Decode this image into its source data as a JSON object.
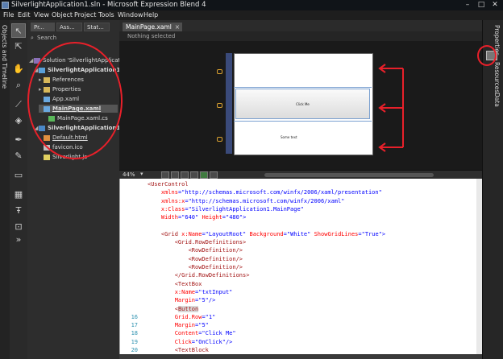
{
  "window": {
    "title": "SilverlightApplication1.sln - Microsoft Expression Blend 4",
    "minimize": "–",
    "maximize": "□",
    "close": "✕"
  },
  "menu": [
    "File",
    "Edit",
    "View",
    "Object",
    "Project",
    "Tools",
    "Window",
    "Help"
  ],
  "left_strip_label": "Objects and Timeline",
  "tools": [
    "selection-icon",
    "direct-select-icon",
    "pan-icon",
    "zoom-icon",
    "eyedropper-icon",
    "paint-bucket-icon",
    "pen-icon",
    "brush-icon",
    "rectangle-icon",
    "layout-grid-icon",
    "textblock-icon",
    "assets-icon",
    "more-tools-icon"
  ],
  "panel": {
    "tabs": [
      "Pr...",
      "Ass...",
      "Stat..."
    ],
    "search_placeholder": "Search",
    "tree": [
      {
        "label": "Solution 'SilverlightApplication",
        "level": 0,
        "icon": "solution-icon"
      },
      {
        "label": "SilverlightApplication1",
        "level": 1,
        "icon": "project-icon",
        "bold": true
      },
      {
        "label": "References",
        "level": 2,
        "icon": "folder-icon"
      },
      {
        "label": "Properties",
        "level": 2,
        "icon": "folder-icon"
      },
      {
        "label": "App.xaml",
        "level": 2,
        "icon": "xaml-file-icon"
      },
      {
        "label": "MainPage.xaml",
        "level": 2,
        "icon": "xaml-file-icon",
        "selected": true,
        "bold": true
      },
      {
        "label": "MainPage.xaml.cs",
        "level": 3,
        "icon": "cs-file-icon"
      },
      {
        "label": "SilverlightApplication1Site",
        "level": 1,
        "icon": "web-project-icon",
        "bold": true
      },
      {
        "label": "Default.html",
        "level": 2,
        "icon": "html-file-icon"
      },
      {
        "label": "favicon.ico",
        "level": 2,
        "icon": "ico-file-icon"
      },
      {
        "label": "Silverlight.js",
        "level": 2,
        "icon": "js-file-icon"
      }
    ]
  },
  "document": {
    "tab_label": "MainPage.xaml",
    "tab_close": "×",
    "selection_info": "Nothing selected",
    "button_text": "Click Me",
    "textblock_text": "Some text"
  },
  "right_strip": [
    "Properties",
    "Resources",
    "Data"
  ],
  "zoom": "44%",
  "code_lines": [
    {
      "n": "",
      "parts": [
        [
          "t",
          "<UserControl"
        ]
      ]
    },
    {
      "n": "",
      "parts": [
        [
          "a",
          "    xmlns"
        ],
        [
          "p",
          "=\""
        ],
        [
          "v",
          "http://schemas.microsoft.com/winfx/2006/xaml/presentation"
        ],
        [
          "p",
          "\""
        ]
      ]
    },
    {
      "n": "",
      "parts": [
        [
          "a",
          "    xmlns:x"
        ],
        [
          "p",
          "=\""
        ],
        [
          "v",
          "http://schemas.microsoft.com/winfx/2006/xaml"
        ],
        [
          "p",
          "\""
        ]
      ]
    },
    {
      "n": "",
      "parts": [
        [
          "a",
          "    x:Class"
        ],
        [
          "p",
          "=\""
        ],
        [
          "v",
          "SilverlightApplication1.MainPage"
        ],
        [
          "p",
          "\""
        ]
      ]
    },
    {
      "n": "",
      "parts": [
        [
          "a",
          "    Width"
        ],
        [
          "p",
          "=\""
        ],
        [
          "v",
          "640"
        ],
        [
          "p",
          "\" "
        ],
        [
          "a",
          "Height"
        ],
        [
          "p",
          "=\""
        ],
        [
          "v",
          "480"
        ],
        [
          "p",
          "\">"
        ]
      ]
    },
    {
      "n": "",
      "parts": []
    },
    {
      "n": "",
      "parts": [
        [
          "t",
          "    <Grid "
        ],
        [
          "a",
          "x:Name"
        ],
        [
          "p",
          "=\""
        ],
        [
          "v",
          "LayoutRoot"
        ],
        [
          "p",
          "\" "
        ],
        [
          "a",
          "Background"
        ],
        [
          "p",
          "=\""
        ],
        [
          "v",
          "White"
        ],
        [
          "p",
          "\" "
        ],
        [
          "a",
          "ShowGridLines"
        ],
        [
          "p",
          "=\""
        ],
        [
          "v",
          "True"
        ],
        [
          "p",
          "\">"
        ]
      ]
    },
    {
      "n": "",
      "parts": [
        [
          "t",
          "        <Grid.RowDefinitions>"
        ]
      ]
    },
    {
      "n": "",
      "parts": [
        [
          "t",
          "            <RowDefinition/>"
        ]
      ]
    },
    {
      "n": "",
      "parts": [
        [
          "t",
          "            <RowDefinition/>"
        ]
      ]
    },
    {
      "n": "",
      "parts": [
        [
          "t",
          "            <RowDefinition/>"
        ]
      ]
    },
    {
      "n": "",
      "parts": [
        [
          "t",
          "        </Grid.RowDefinitions>"
        ]
      ]
    },
    {
      "n": "",
      "parts": [
        [
          "t",
          "        <TextBox"
        ]
      ]
    },
    {
      "n": "",
      "parts": [
        [
          "a",
          "        x:Name"
        ],
        [
          "p",
          "=\""
        ],
        [
          "v",
          "txtInput"
        ],
        [
          "p",
          "\""
        ]
      ]
    },
    {
      "n": "",
      "parts": [
        [
          "a",
          "        Margin"
        ],
        [
          "p",
          "=\""
        ],
        [
          "v",
          "5"
        ],
        [
          "p",
          "\"/>"
        ]
      ]
    },
    {
      "n": "",
      "parts": [
        [
          "t",
          "        <"
        ],
        [
          "h",
          "Button"
        ]
      ]
    },
    {
      "n": "16",
      "parts": [
        [
          "a",
          "        Grid.Row"
        ],
        [
          "p",
          "=\""
        ],
        [
          "v",
          "1"
        ],
        [
          "p",
          "\""
        ]
      ]
    },
    {
      "n": "17",
      "parts": [
        [
          "a",
          "        Margin"
        ],
        [
          "p",
          "=\""
        ],
        [
          "v",
          "5"
        ],
        [
          "p",
          "\""
        ]
      ]
    },
    {
      "n": "18",
      "parts": [
        [
          "a",
          "        Content"
        ],
        [
          "p",
          "=\""
        ],
        [
          "v",
          "Click Me"
        ],
        [
          "p",
          "\""
        ]
      ]
    },
    {
      "n": "19",
      "parts": [
        [
          "a",
          "        Click"
        ],
        [
          "p",
          "=\""
        ],
        [
          "v",
          "OnClick"
        ],
        [
          "p",
          "\"/>"
        ]
      ]
    },
    {
      "n": "20",
      "parts": [
        [
          "t",
          "        <TextBlock"
        ]
      ]
    }
  ],
  "colors": {
    "annotation": "#e8202a",
    "accent": "#7aa0d0"
  }
}
